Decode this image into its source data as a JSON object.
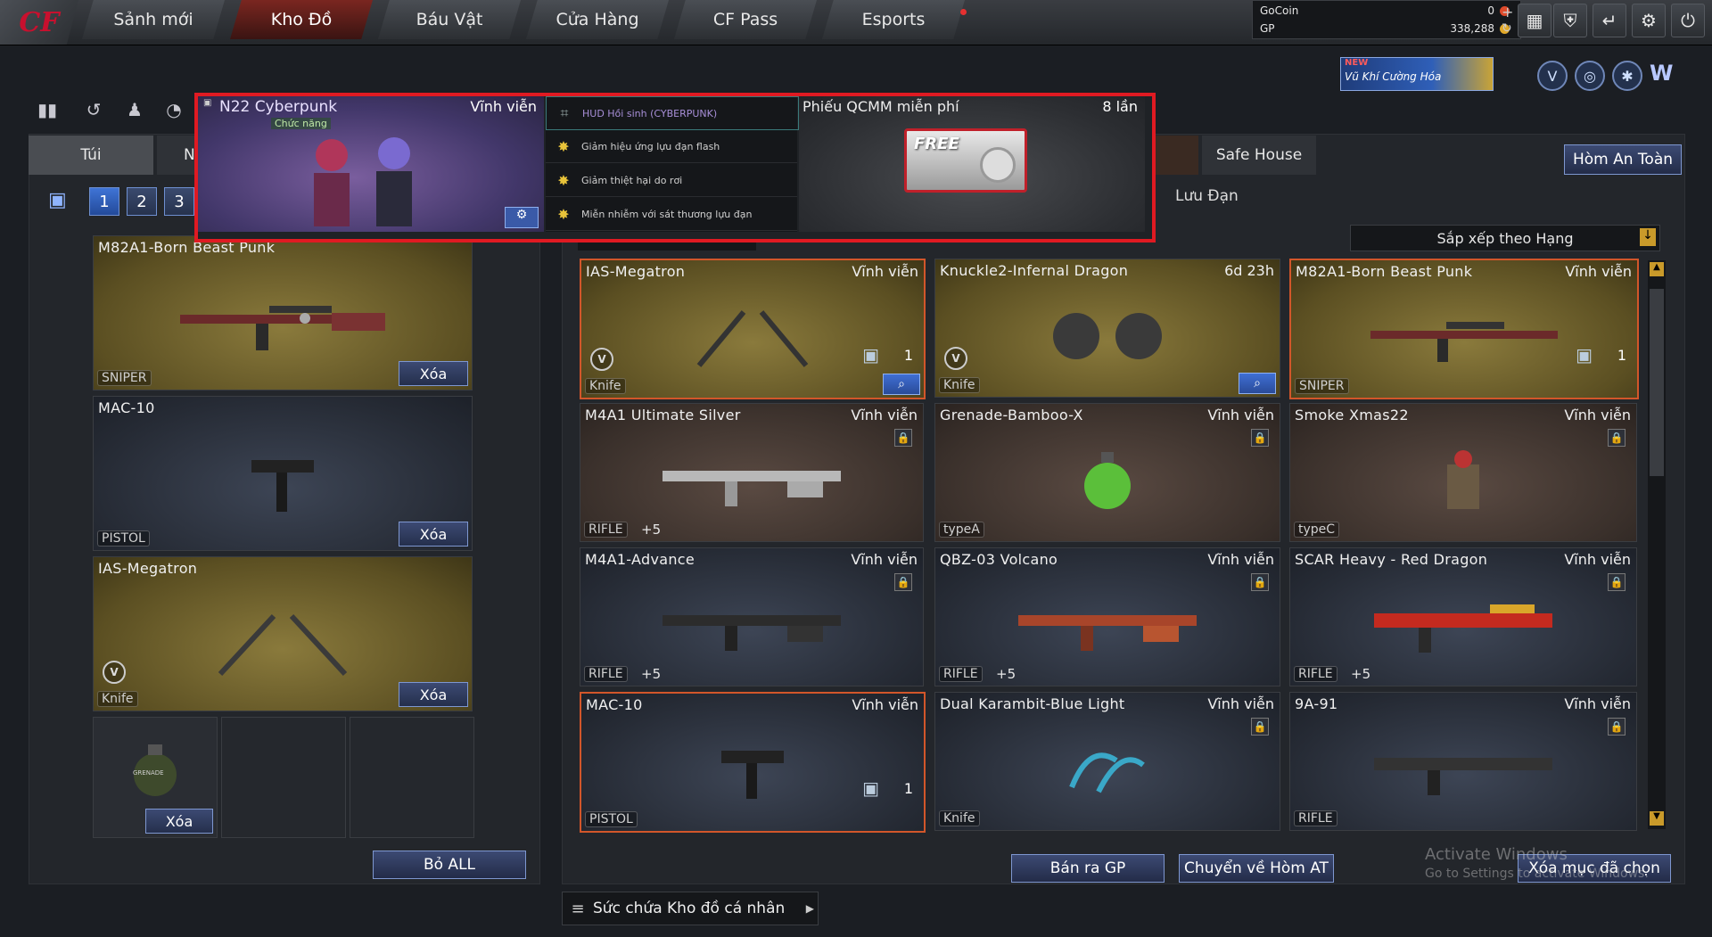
{
  "nav": {
    "logo": "CF",
    "tabs": [
      "Sảnh mới",
      "Kho Đồ",
      "Báu Vật",
      "Cửa Hàng",
      "CF Pass",
      "Esports"
    ],
    "active": "Kho Đồ"
  },
  "currency": {
    "gocoin_label": "GoCoin",
    "gocoin_value": "0",
    "gp_label": "GP",
    "gp_value": "338,288"
  },
  "banner": {
    "new_label": "NEW",
    "text": "Vũ Khí Cường Hóa"
  },
  "left": {
    "tabs": [
      "Túi",
      "N"
    ],
    "pages": [
      "1",
      "2",
      "3"
    ],
    "delete_all": "Bỏ ALL",
    "slots": [
      {
        "name": "M82A1-Born Beast Punk",
        "type": "SNIPER",
        "delete": "Xóa"
      },
      {
        "name": "MAC-10",
        "type": "PISTOL",
        "delete": "Xóa"
      },
      {
        "name": "IAS-Megatron",
        "type": "Knife",
        "delete": "Xóa"
      }
    ],
    "grenade_delete": "Xóa",
    "grenade_label": "GRENADE"
  },
  "right": {
    "tabs": [
      "Safe House"
    ],
    "safe_box": "Hòm An Toàn",
    "ammo_label": "Lưu Đạn",
    "sort": "Sắp xếp theo Hạng",
    "items": [
      {
        "name": "IAS-Megatron",
        "dur": "Vĩnh viễn",
        "type": "Knife",
        "count": "1"
      },
      {
        "name": "Knuckle2-Infernal Dragon",
        "dur": "6d 23h",
        "type": "Knife"
      },
      {
        "name": "M82A1-Born Beast Punk",
        "dur": "Vĩnh viễn",
        "type": "SNIPER",
        "count": "1"
      },
      {
        "name": "M4A1 Ultimate Silver",
        "dur": "Vĩnh viễn",
        "type": "RIFLE",
        "bonus": "+5"
      },
      {
        "name": "Grenade-Bamboo-X",
        "dur": "Vĩnh viễn",
        "type": "typeA"
      },
      {
        "name": "Smoke Xmas22",
        "dur": "Vĩnh viễn",
        "type": "typeC"
      },
      {
        "name": "M4A1-Advance",
        "dur": "Vĩnh viễn",
        "type": "RIFLE",
        "bonus": "+5"
      },
      {
        "name": "QBZ-03 Volcano",
        "dur": "Vĩnh viễn",
        "type": "RIFLE",
        "bonus": "+5"
      },
      {
        "name": "SCAR Heavy - Red Dragon",
        "dur": "Vĩnh viễn",
        "type": "RIFLE",
        "bonus": "+5"
      },
      {
        "name": "MAC-10",
        "dur": "Vĩnh viễn",
        "type": "PISTOL",
        "count": "1"
      },
      {
        "name": "Dual Karambit-Blue Light",
        "dur": "Vĩnh viễn",
        "type": "Knife"
      },
      {
        "name": "9A-91",
        "dur": "Vĩnh viễn",
        "type": "RIFLE"
      }
    ],
    "sell": "Bán ra GP",
    "transfer": "Chuyển về Hòm AT",
    "delete_selected": "Xóa mục đã chọn"
  },
  "overlay": {
    "item_name": "N22 Cyberpunk",
    "item_dur": "Vĩnh viễn",
    "item_sub": "Chức năng",
    "features": [
      "HUD Hồi sinh (CYBERPUNK)",
      "Giảm hiệu ứng lựu đạn flash",
      "Giảm thiệt hại do rơi",
      "Miễn nhiễm với sát thương lựu đạn"
    ],
    "ticket_name": "Phiếu QCMM miễn phí",
    "ticket_count": "8 lần",
    "ticket_badge": "FREE"
  },
  "footer": {
    "storage": "Sức chứa Kho đồ cá nhân"
  },
  "watermark": {
    "line1": "Activate Windows",
    "line2": "Go to Settings to activate Windows."
  },
  "colors": {
    "accent": "#d2562a",
    "button": "#2a4b98",
    "overlay_border": "#e01a22"
  }
}
